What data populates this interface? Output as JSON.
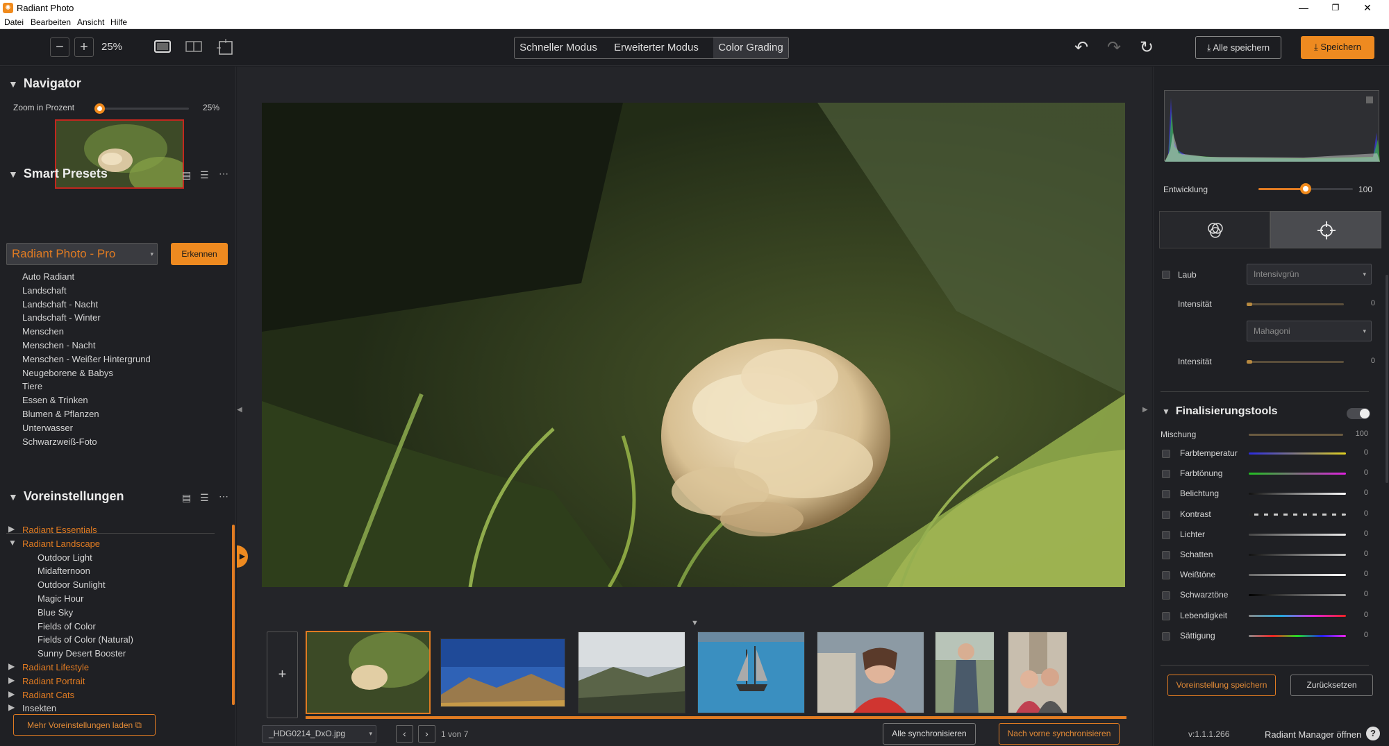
{
  "app": {
    "title": "Radiant Photo",
    "icon_name": "radiant-app-icon",
    "accent": "#f08a1c"
  },
  "window_controls": {
    "minimize": "—",
    "maximize": "❐",
    "close": "✕"
  },
  "menu": [
    "Datei",
    "Bearbeiten",
    "Ansicht",
    "Hilfe"
  ],
  "toolbar": {
    "zoom_out": "−",
    "zoom_in": "+",
    "zoom_value": "25%",
    "modes": [
      "Schneller Modus",
      "Erweiterter Modus",
      "Color Grading"
    ],
    "active_mode": "Color Grading",
    "save_all": "Alle speichern",
    "save": "Speichern"
  },
  "navigator": {
    "title": "Navigator",
    "zoom_label": "Zoom in Prozent",
    "zoom_value": "25%",
    "zoom_level": 0.12
  },
  "smart_presets": {
    "title": "Smart Presets",
    "selected": "Radiant Photo - Pro",
    "detect_button": "Erkennen",
    "items": [
      "Auto Radiant",
      "Landschaft",
      "Landschaft - Nacht",
      "Landschaft - Winter",
      "Menschen",
      "Menschen - Nacht",
      "Menschen - Weißer Hintergrund",
      "Neugeborene & Babys",
      "Tiere",
      "Essen & Trinken",
      "Blumen & Pflanzen",
      "Unterwasser",
      "Schwarzweiß-Foto"
    ]
  },
  "presets": {
    "title": "Voreinstellungen",
    "groups": [
      {
        "name": "Radiant Essentials",
        "expanded": false,
        "items": []
      },
      {
        "name": "Radiant Landscape",
        "expanded": true,
        "items": [
          "Outdoor Light",
          "Midafternoon",
          "Outdoor Sunlight",
          "Magic Hour",
          "Blue Sky",
          "Fields of Color",
          "Fields of Color (Natural)",
          "Sunny Desert Booster"
        ]
      },
      {
        "name": "Radiant Lifestyle",
        "expanded": false,
        "items": []
      },
      {
        "name": "Radiant Portrait",
        "expanded": false,
        "items": []
      },
      {
        "name": "Radiant Cats",
        "expanded": false,
        "items": []
      },
      {
        "name": "Insekten",
        "expanded": false,
        "items": []
      }
    ],
    "more_button": "Mehr Voreinstellungen laden"
  },
  "filmstrip": {
    "add_label": "+",
    "filename": "_HDG0214_DxO.jpg",
    "page_info": "1 von 7",
    "sync_all": "Alle synchronisieren",
    "sync_forward": "Nach vorne synchronisieren"
  },
  "right": {
    "development_label": "Entwicklung",
    "development_value": "100",
    "development_level": 0.5,
    "foliage": {
      "label": "Laub",
      "select1": "Intensivgrün",
      "intensity_label": "Intensität",
      "intensity_value": "0",
      "select2": "Mahagoni",
      "intensity2_label": "Intensität",
      "intensity2_value": "0"
    },
    "finishing": {
      "title": "Finalisierungstools",
      "mix_label": "Mischung",
      "mix_value": "100",
      "sliders": [
        {
          "label": "Farbtemperatur",
          "value": "0"
        },
        {
          "label": "Farbtönung",
          "value": "0"
        },
        {
          "label": "Belichtung",
          "value": "0"
        },
        {
          "label": "Kontrast",
          "value": "0"
        },
        {
          "label": "Lichter",
          "value": "0"
        },
        {
          "label": "Schatten",
          "value": "0"
        },
        {
          "label": "Weißtöne",
          "value": "0"
        },
        {
          "label": "Schwarztöne",
          "value": "0"
        },
        {
          "label": "Lebendigkeit",
          "value": "0"
        },
        {
          "label": "Sättigung",
          "value": "0"
        }
      ]
    },
    "save_preset": "Voreinstellung speichern",
    "reset": "Zurücksetzen",
    "version": "v:1.1.1.266",
    "manager": "Radiant Manager öffnen"
  }
}
